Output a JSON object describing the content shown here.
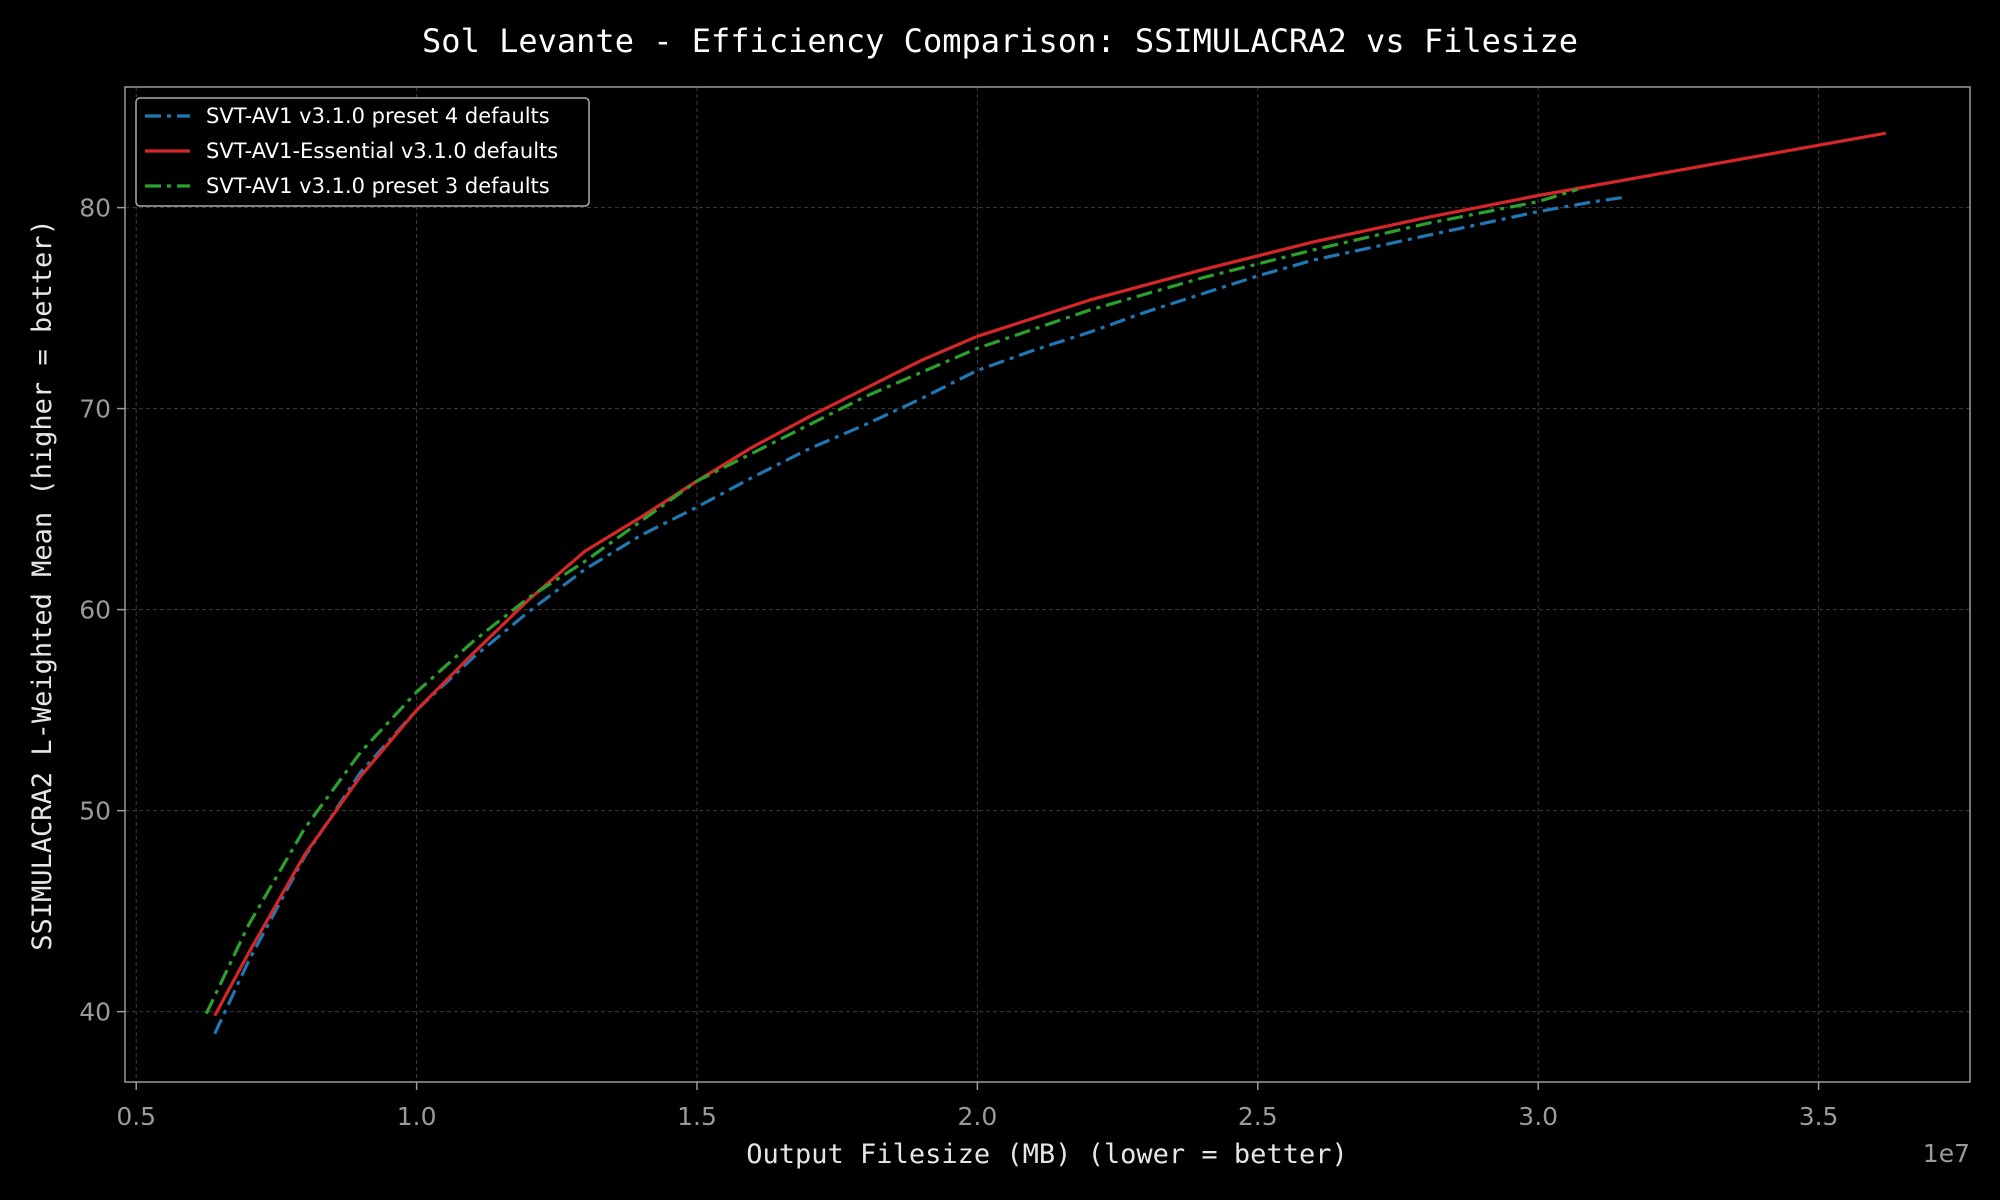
{
  "chart_data": {
    "type": "line",
    "title": "Sol Levante - Efficiency Comparison: SSIMULACRA2 vs Filesize",
    "xlabel": "Output Filesize (MB) (lower = better)",
    "ylabel": "SSIMULACRA2 L-Weighted Mean (higher = better)",
    "x_offset_label": "1e7",
    "xlim": [
      0.48,
      3.77
    ],
    "ylim": [
      36.5,
      86.0
    ],
    "xticks": [
      0.5,
      1.0,
      1.5,
      2.0,
      2.5,
      3.0,
      3.5
    ],
    "xtick_labels": [
      "0.5",
      "1.0",
      "1.5",
      "2.0",
      "2.5",
      "3.0",
      "3.5"
    ],
    "yticks": [
      40,
      50,
      60,
      70,
      80
    ],
    "ytick_labels": [
      "40",
      "50",
      "60",
      "70",
      "80"
    ],
    "grid": true,
    "legend_position": "top-left",
    "series": [
      {
        "name": "SVT-AV1 v3.1.0 preset 4 defaults",
        "color": "#1f77b4",
        "style": "dashdot",
        "x": [
          0.64,
          0.7,
          0.8,
          0.9,
          1.0,
          1.1,
          1.2,
          1.3,
          1.4,
          1.5,
          1.6,
          1.7,
          1.8,
          1.9,
          2.0,
          2.1,
          2.2,
          2.3,
          2.4,
          2.5,
          2.6,
          2.7,
          2.8,
          2.9,
          3.0,
          3.1,
          3.15
        ],
        "y": [
          38.9,
          42.5,
          47.7,
          51.9,
          55.0,
          57.6,
          59.9,
          62.0,
          63.7,
          65.1,
          66.6,
          68.0,
          69.2,
          70.5,
          71.9,
          72.9,
          73.8,
          74.8,
          75.7,
          76.6,
          77.4,
          78.0,
          78.6,
          79.2,
          79.8,
          80.3,
          80.5
        ]
      },
      {
        "name": "SVT-AV1-Essential v3.1.0 defaults",
        "color": "#d62728",
        "style": "solid",
        "x": [
          0.64,
          0.7,
          0.8,
          0.9,
          1.0,
          1.1,
          1.2,
          1.3,
          1.4,
          1.5,
          1.6,
          1.7,
          1.8,
          1.9,
          2.0,
          2.2,
          2.4,
          2.6,
          2.8,
          3.0,
          3.2,
          3.4,
          3.6,
          3.62
        ],
        "y": [
          39.8,
          42.9,
          47.8,
          51.7,
          55.0,
          57.8,
          60.5,
          62.9,
          64.6,
          66.4,
          68.1,
          69.6,
          71.0,
          72.4,
          73.6,
          75.4,
          76.9,
          78.3,
          79.5,
          80.6,
          81.6,
          82.6,
          83.6,
          83.7
        ]
      },
      {
        "name": "SVT-AV1 v3.1.0 preset 3 defaults",
        "color": "#2ca02c",
        "style": "dashdot",
        "x": [
          0.625,
          0.7,
          0.8,
          0.9,
          1.0,
          1.1,
          1.2,
          1.3,
          1.4,
          1.5,
          1.6,
          1.7,
          1.8,
          1.9,
          2.0,
          2.2,
          2.4,
          2.6,
          2.8,
          3.0,
          3.07
        ],
        "y": [
          39.9,
          44.3,
          49.1,
          52.9,
          55.9,
          58.4,
          60.6,
          62.4,
          64.4,
          66.4,
          67.8,
          69.2,
          70.6,
          71.8,
          73.0,
          74.9,
          76.5,
          77.9,
          79.2,
          80.3,
          80.9
        ]
      }
    ]
  }
}
